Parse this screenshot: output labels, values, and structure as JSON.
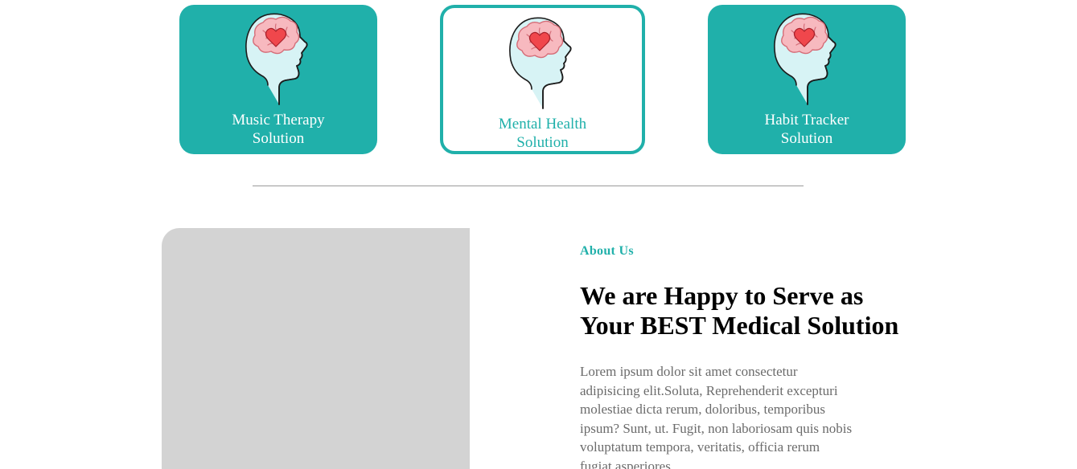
{
  "colors": {
    "accent": "#20b0aa",
    "card_text": "#ffffff",
    "placeholder": "#d3d3d3",
    "body_text": "#6b6b6b",
    "heading": "#000000",
    "heart": "#f0474c",
    "brain": "#f7b9bf"
  },
  "solutions": [
    {
      "line1": "Music Therapy",
      "line2": "Solution",
      "icon": "brain-heart-icon",
      "style": "filled"
    },
    {
      "line1": "Mental Health",
      "line2": "Solution",
      "icon": "brain-heart-icon",
      "style": "outlined"
    },
    {
      "line1": "Habit Tracker",
      "line2": "Solution",
      "icon": "brain-heart-icon",
      "style": "filled"
    }
  ],
  "about": {
    "eyebrow": "About Us",
    "headline_line1": "We are Happy to Serve as",
    "headline_line2": "Your BEST Medical Solution",
    "body": "Lorem ipsum dolor sit amet consectetur adipisicing elit.Soluta, Reprehenderit excepturi molestiae dicta rerum, doloribus, temporibus ipsum? Sunt, ut. Fugit, non laboriosam quis nobis voluptatum tempora, veritatis, officia rerum fugiat asperiores"
  }
}
